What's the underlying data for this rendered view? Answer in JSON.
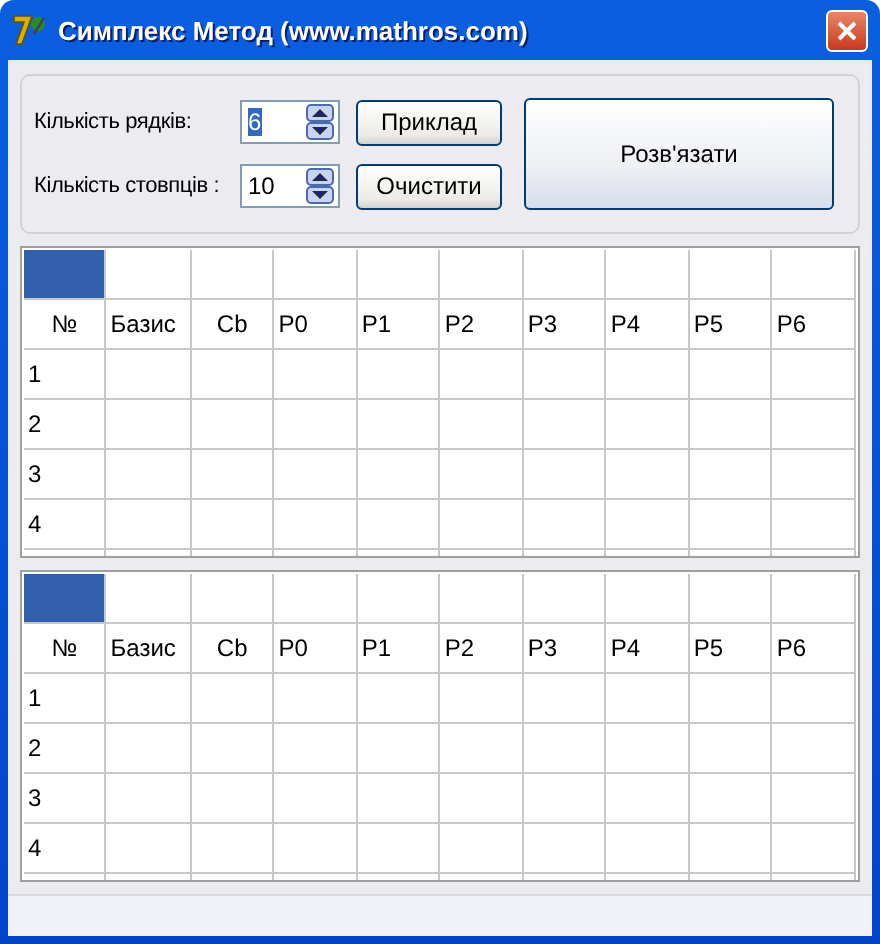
{
  "window": {
    "title": "Симплекс Метод (www.mathros.com)"
  },
  "settings": {
    "fields": [
      {
        "label": "Кількість рядків:",
        "value": "6",
        "value_selected": true
      },
      {
        "label": "Кількість стовпців  :",
        "value": "10",
        "value_selected": false
      }
    ],
    "buttons": [
      "Приклад",
      "Очистити"
    ],
    "solve_button": "Розв'язати"
  },
  "grids": [
    {
      "corner_selected": true,
      "columns": [
        "№",
        "Базис",
        "Cb",
        "P0",
        "P1",
        "P2",
        "P3",
        "P4",
        "P5",
        "P6"
      ],
      "rows": [
        "1",
        "2",
        "3",
        "4"
      ]
    },
    {
      "corner_selected": true,
      "columns": [
        "№",
        "Базис",
        "Cb",
        "P0",
        "P1",
        "P2",
        "P3",
        "P4",
        "P5",
        "P6"
      ],
      "rows": [
        "1",
        "2",
        "3",
        "4"
      ]
    }
  ]
}
